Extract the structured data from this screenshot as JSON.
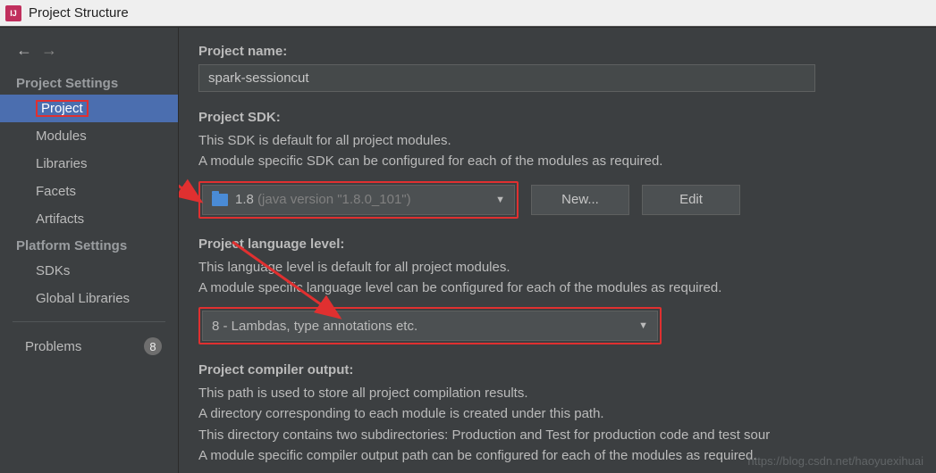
{
  "window": {
    "title": "Project Structure"
  },
  "sidebar": {
    "section1": "Project Settings",
    "items1": [
      "Project",
      "Modules",
      "Libraries",
      "Facets",
      "Artifacts"
    ],
    "section2": "Platform Settings",
    "items2": [
      "SDKs",
      "Global Libraries"
    ],
    "problems_label": "Problems",
    "problems_count": "8"
  },
  "project": {
    "name_label": "Project name:",
    "name_value": "spark-sessioncut",
    "sdk_label": "Project SDK:",
    "sdk_desc1": "This SDK is default for all project modules.",
    "sdk_desc2": "A module specific SDK can be configured for each of the modules as required.",
    "sdk_value_main": "1.8",
    "sdk_value_dim": "(java version \"1.8.0_101\")",
    "btn_new": "New...",
    "btn_edit": "Edit",
    "lang_label": "Project language level:",
    "lang_desc1": "This language level is default for all project modules.",
    "lang_desc2": "A module specific language level can be configured for each of the modules as required.",
    "lang_value": "8 - Lambdas, type annotations etc.",
    "out_label": "Project compiler output:",
    "out_desc1": "This path is used to store all project compilation results.",
    "out_desc2": "A directory corresponding to each module is created under this path.",
    "out_desc3": "This directory contains two subdirectories: Production and Test for production code and test sour",
    "out_desc4": "A module specific compiler output path can be configured for each of the modules as required."
  },
  "watermark": "https://blog.csdn.net/haoyuexihuai"
}
